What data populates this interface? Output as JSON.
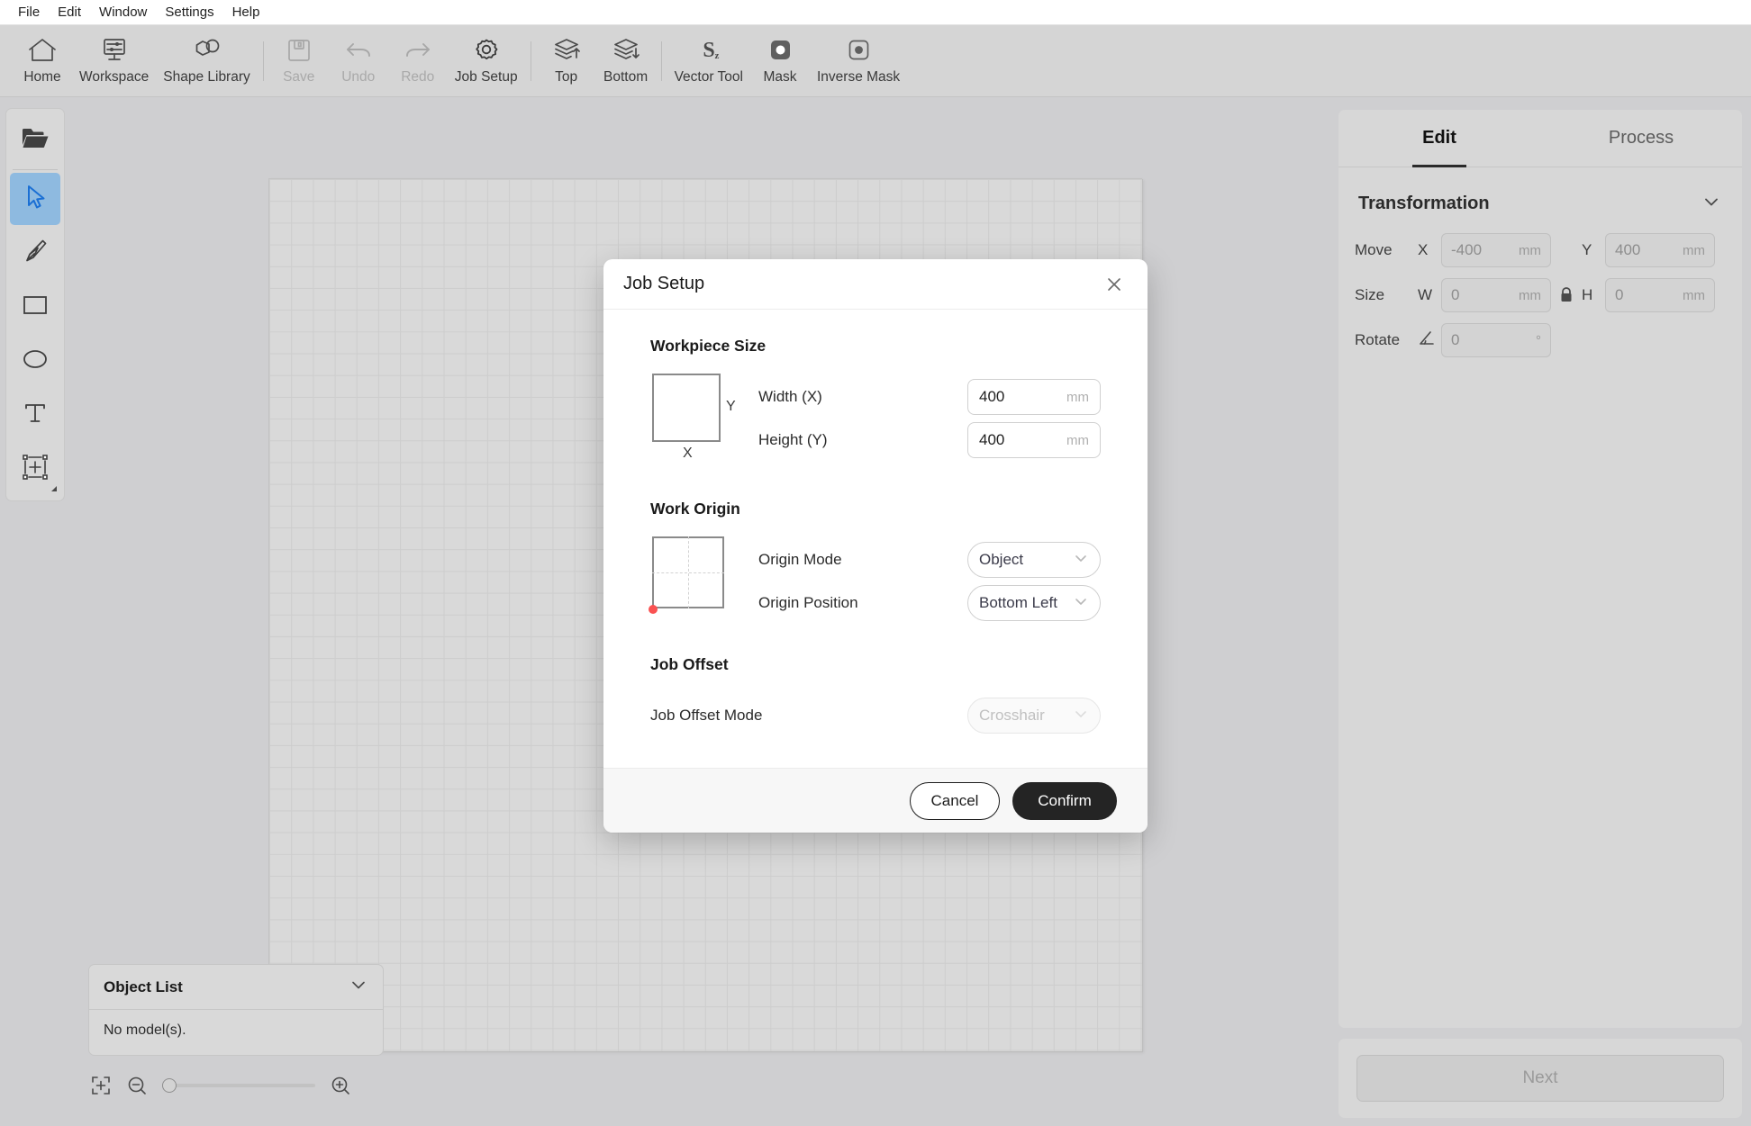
{
  "menubar": {
    "items": [
      {
        "label": "File"
      },
      {
        "label": "Edit"
      },
      {
        "label": "Window"
      },
      {
        "label": "Settings"
      },
      {
        "label": "Help"
      }
    ]
  },
  "toolbar": {
    "items": [
      {
        "label": "Home",
        "icon": "home-icon",
        "enabled": true
      },
      {
        "label": "Workspace",
        "icon": "workspace-icon",
        "enabled": true
      },
      {
        "label": "Shape Library",
        "icon": "shape-library-icon",
        "enabled": true
      },
      {
        "label": "Save",
        "icon": "save-icon",
        "enabled": false
      },
      {
        "label": "Undo",
        "icon": "undo-icon",
        "enabled": false
      },
      {
        "label": "Redo",
        "icon": "redo-icon",
        "enabled": false
      },
      {
        "label": "Job Setup",
        "icon": "gear-icon",
        "enabled": true
      },
      {
        "label": "Top",
        "icon": "layer-up-icon",
        "enabled": true
      },
      {
        "label": "Bottom",
        "icon": "layer-down-icon",
        "enabled": true
      },
      {
        "label": "Vector Tool",
        "icon": "vector-tool-icon",
        "enabled": true
      },
      {
        "label": "Mask",
        "icon": "mask-icon",
        "enabled": true
      },
      {
        "label": "Inverse Mask",
        "icon": "inverse-mask-icon",
        "enabled": true
      }
    ]
  },
  "leftbar": {
    "items": [
      {
        "name": "open-file-tool",
        "icon": "folder-open-icon",
        "active": false
      },
      {
        "name": "select-tool",
        "icon": "cursor-arrow-icon",
        "active": true
      },
      {
        "name": "pen-tool",
        "icon": "pen-nib-icon",
        "active": false
      },
      {
        "name": "rectangle-tool",
        "icon": "rectangle-icon",
        "active": false
      },
      {
        "name": "ellipse-tool",
        "icon": "ellipse-icon",
        "active": false
      },
      {
        "name": "text-tool",
        "icon": "text-t-icon",
        "active": false
      },
      {
        "name": "add-shape-tool",
        "icon": "add-frame-icon",
        "active": false
      }
    ]
  },
  "object_list": {
    "title": "Object List",
    "empty_text": "No model(s).",
    "collapse_icon": "chevron-down-icon"
  },
  "zoom_controls": {
    "fit_icon": "fit-to-screen-icon",
    "zoom_out_icon": "zoom-out-icon",
    "zoom_in_icon": "zoom-in-icon",
    "slider_value": 0
  },
  "right_panel": {
    "tabs": [
      {
        "label": "Edit",
        "active": true
      },
      {
        "label": "Process",
        "active": false
      }
    ],
    "transformation": {
      "title": "Transformation",
      "collapse_icon": "chevron-down-icon",
      "rows": [
        {
          "label": "Move",
          "fields": [
            {
              "axis": "X",
              "value": "-400",
              "unit": "mm"
            },
            {
              "axis": "Y",
              "value": "400",
              "unit": "mm"
            }
          ]
        },
        {
          "label": "Size",
          "lock_icon": "lock-closed-icon",
          "fields": [
            {
              "axis": "W",
              "value": "0",
              "unit": "mm"
            },
            {
              "axis": "H",
              "value": "0",
              "unit": "mm"
            }
          ]
        },
        {
          "label": "Rotate",
          "angle_icon": "angle-icon",
          "fields": [
            {
              "axis": "",
              "value": "0",
              "unit": "°"
            }
          ]
        }
      ]
    },
    "next_button": {
      "label": "Next",
      "enabled": false
    }
  },
  "modal": {
    "title": "Job Setup",
    "close_icon": "close-icon",
    "workpiece_size": {
      "title": "Workpiece Size",
      "diagram": {
        "x_label": "X",
        "y_label": "Y"
      },
      "width": {
        "label": "Width (X)",
        "value": "400",
        "unit": "mm"
      },
      "height": {
        "label": "Height (Y)",
        "value": "400",
        "unit": "mm"
      }
    },
    "work_origin": {
      "title": "Work Origin",
      "origin_mode": {
        "label": "Origin Mode",
        "value": "Object",
        "icon": "chevron-down-icon"
      },
      "origin_position": {
        "label": "Origin Position",
        "value": "Bottom Left",
        "icon": "chevron-down-icon"
      }
    },
    "job_offset": {
      "title": "Job Offset",
      "offset_mode": {
        "label": "Job Offset Mode",
        "value": "Crosshair",
        "icon": "chevron-down-icon",
        "enabled": false
      }
    },
    "footer": {
      "cancel_label": "Cancel",
      "confirm_label": "Confirm"
    }
  },
  "colors": {
    "accent": "#8ebae0",
    "origin_dot": "#fa5252",
    "confirm_bg": "#242424"
  }
}
